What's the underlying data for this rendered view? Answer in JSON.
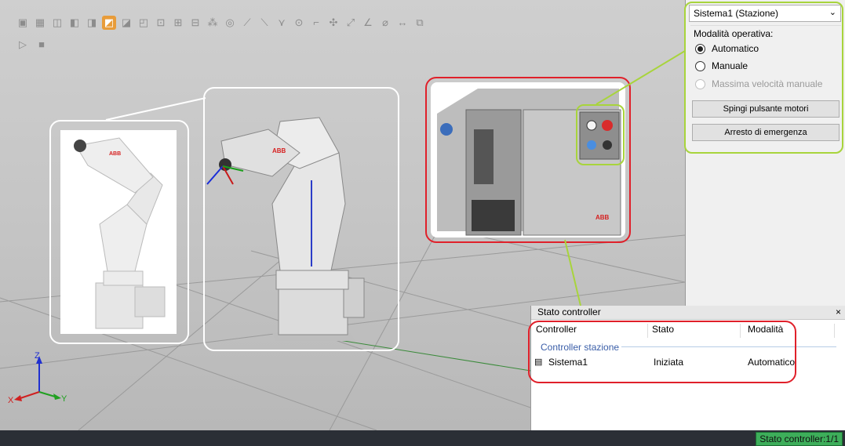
{
  "panel": {
    "system_combo": "Sistema1 (Stazione)",
    "mode_group_title": "Modalità operativa:",
    "modes": [
      {
        "label": "Automatico",
        "selected": true,
        "enabled": true
      },
      {
        "label": "Manuale",
        "selected": false,
        "enabled": true
      },
      {
        "label": "Massima velocità manuale",
        "selected": false,
        "enabled": false
      }
    ],
    "motors_button": "Spingi pulsante motori",
    "emergency_button": "Arresto di emergenza"
  },
  "controller_window": {
    "title": "Stato controller",
    "close": "×",
    "columns": [
      "Controller",
      "Stato",
      "Modalità"
    ],
    "group": "Controller stazione",
    "rows": [
      {
        "controller": "Sistema1",
        "stato": "Iniziata",
        "modalita": "Automatico"
      }
    ]
  },
  "statusbar": {
    "controller_status": "Stato controller:1/1"
  },
  "axes": {
    "z": "Z",
    "x": "X",
    "y": "Y"
  },
  "colors": {
    "highlight_red": "#e0202a",
    "highlight_green": "#a8d43c",
    "status_green": "#3dae5a"
  }
}
